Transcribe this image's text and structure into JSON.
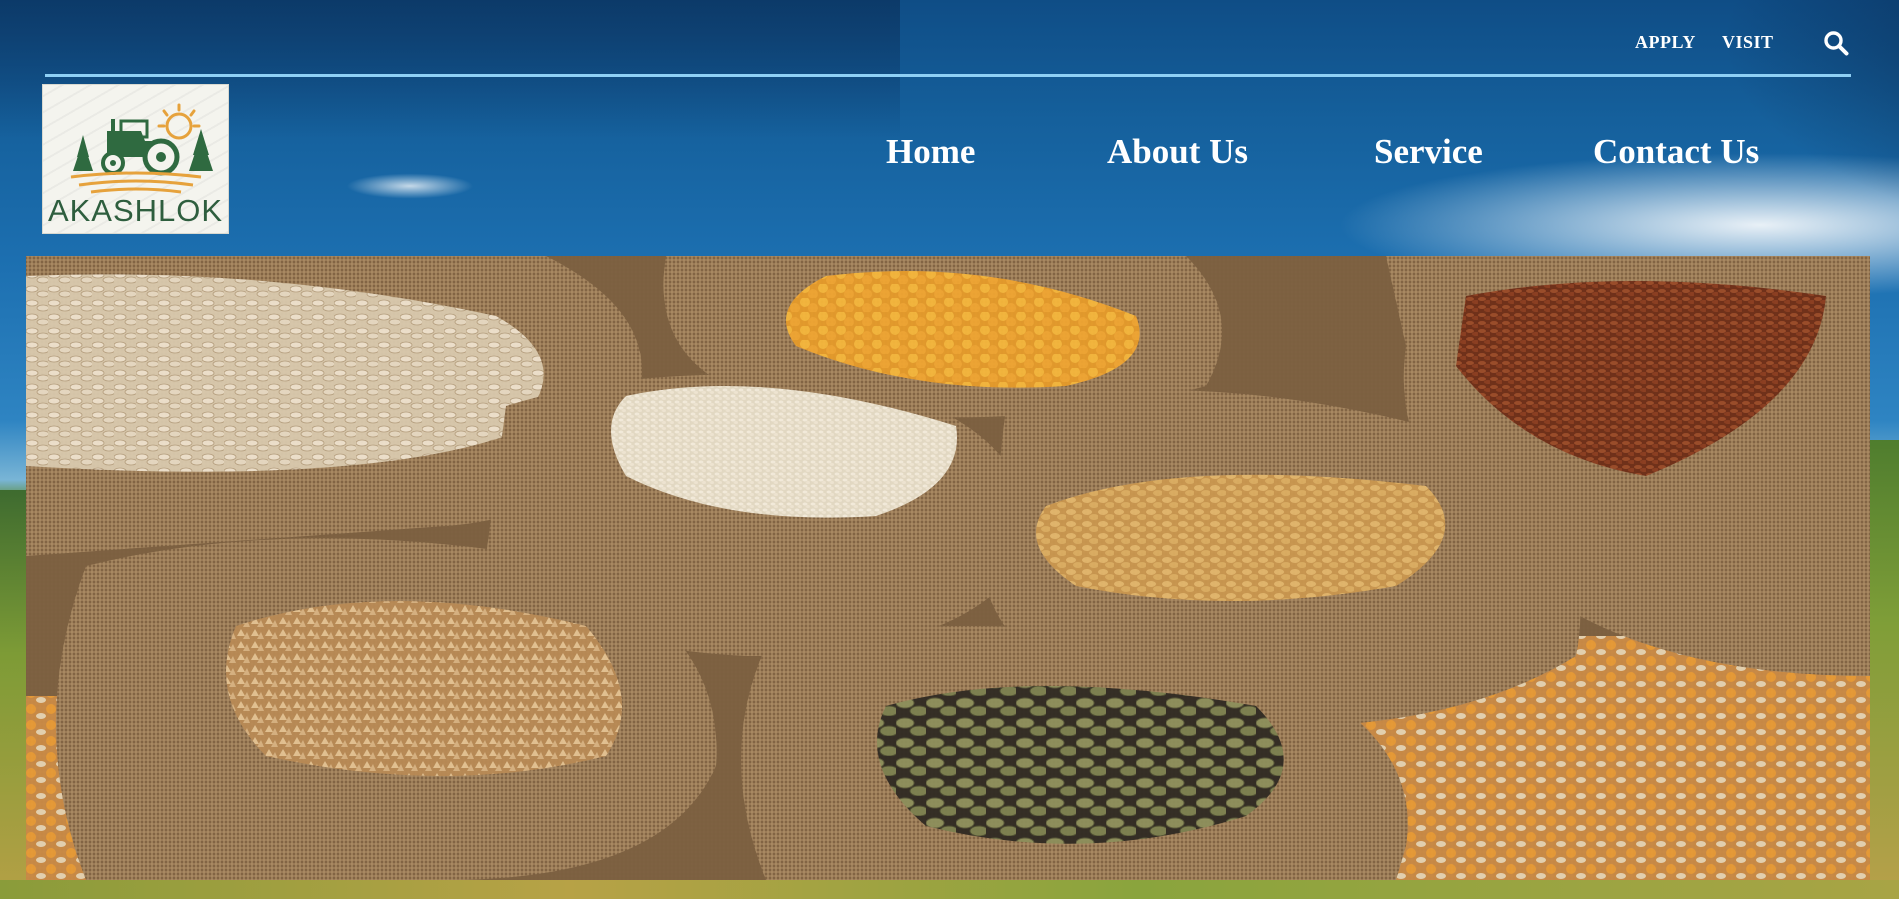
{
  "topbar": {
    "links": [
      {
        "label": "APPLY"
      },
      {
        "label": "VISIT"
      }
    ],
    "search_icon": "search-icon",
    "divider_color": "#8fd0f5"
  },
  "logo": {
    "text": "AKASHLOK",
    "icon": "tractor-logo-icon",
    "text_color": "#2e5e3e"
  },
  "nav": {
    "items": [
      {
        "label": "Home"
      },
      {
        "label": "About Us"
      },
      {
        "label": "Service"
      },
      {
        "label": "Contact Us"
      }
    ]
  },
  "hero": {
    "image": "grain-sacks-image",
    "description_icons": [
      "burlap-sack-icon"
    ]
  },
  "colors": {
    "nav_text": "#ffffff",
    "sky_top": "#0f4d86",
    "burlap": "#9a7b57"
  }
}
